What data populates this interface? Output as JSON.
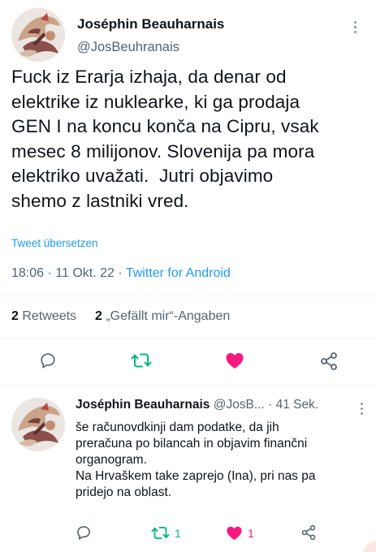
{
  "colors": {
    "accent": "#1d9bf0",
    "retweet": "#00ba7c",
    "like": "#f91880",
    "secondary_text": "#536471",
    "divider": "#eff3f4"
  },
  "main_tweet": {
    "author_name": "Joséphin Beauharnais",
    "author_handle": "@JosBeuhranais",
    "text_lines": [
      "Fuck iz Erarja izhaja, da denar od",
      "elektrike iz nuklearke, ki ga prodaja",
      "GEN I na koncu konča na Cipru, vsak",
      "mesec 8 milijonov. Slovenija pa mora",
      "elektriko uvažati.  Jutri objavimo",
      "shemo z lastniki vred."
    ],
    "translate_label": "Tweet übersetzen",
    "time": "18:06",
    "date": "11 Okt. 22",
    "source": "Twitter for Android",
    "retweets_count": "2",
    "retweets_label": "Retweets",
    "likes_count": "2",
    "likes_label": "„Gefällt mir“-Angaben",
    "actions": {
      "reply_icon": "reply-icon",
      "retweet_icon": "retweet-icon",
      "like_icon": "heart-filled-icon",
      "share_icon": "share-icon"
    }
  },
  "reply_tweet": {
    "author_name": "Joséphin Beauharnais",
    "author_handle": "@JosB...",
    "separator": "·",
    "time_ago": "41 Sek.",
    "text_lines": [
      "še računovdkinji dam podatke, da jih",
      "preračuna po bilancah in objavim finančni",
      "organogram.",
      "Na Hrvaškem take zaprejo (Ina), pri nas pa",
      "pridejo na oblast."
    ],
    "retweet_count": "1",
    "like_count": "1"
  }
}
